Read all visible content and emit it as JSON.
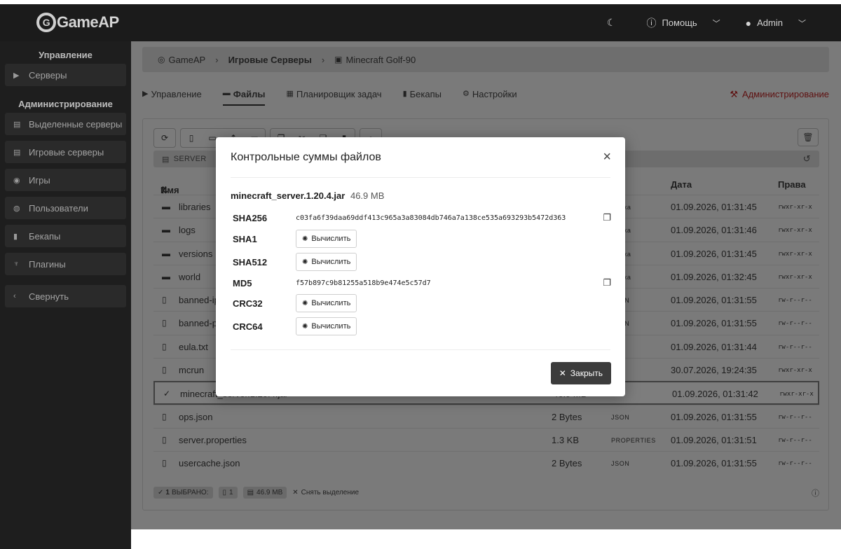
{
  "header": {
    "logo_text": "GameAP",
    "logo_glyph": "G",
    "help_label": "Помощь",
    "user_label": "Admin"
  },
  "sidebar": {
    "section_manage": "Управление",
    "section_admin": "Администрирование",
    "items": [
      {
        "label": "Серверы",
        "icon": "play-icon"
      },
      {
        "label": "Выделенные серверы",
        "icon": "server-icon"
      },
      {
        "label": "Игровые серверы",
        "icon": "server-icon"
      },
      {
        "label": "Игры",
        "icon": "gamepad-icon"
      },
      {
        "label": "Пользователи",
        "icon": "users-icon"
      },
      {
        "label": "Бекапы",
        "icon": "file-icon"
      },
      {
        "label": "Плагины",
        "icon": "plug-icon"
      },
      {
        "label": "Свернуть",
        "icon": "chevron-left-icon"
      }
    ]
  },
  "breadcrumb": {
    "home": "GameAP",
    "section": "Игровые Серверы",
    "server": "Minecraft Golf-90"
  },
  "tabs": {
    "manage": "Управление",
    "files": "Файлы",
    "scheduler": "Планировщик задач",
    "backups": "Бекапы",
    "settings": "Настройки",
    "admin": "Администрирование"
  },
  "filemanager": {
    "path": "SERVER",
    "columns": {
      "name": "Имя",
      "date": "Дата",
      "perms": "Права"
    },
    "rows": [
      {
        "icon": "folder",
        "name": "libraries",
        "size": "",
        "type": "Папка",
        "date": "01.09.2026, 01:31:45",
        "perms": "rwxr-xr-x"
      },
      {
        "icon": "folder",
        "name": "logs",
        "size": "",
        "type": "Папка",
        "date": "01.09.2026, 01:31:46",
        "perms": "rwxr-xr-x"
      },
      {
        "icon": "folder",
        "name": "versions",
        "size": "",
        "type": "Папка",
        "date": "01.09.2026, 01:31:45",
        "perms": "rwxr-xr-x"
      },
      {
        "icon": "folder",
        "name": "world",
        "size": "",
        "type": "Папка",
        "date": "01.09.2026, 01:32:45",
        "perms": "rwxr-xr-x"
      },
      {
        "icon": "file",
        "name": "banned-ips.json",
        "size": "",
        "type": "JSON",
        "date": "01.09.2026, 01:31:55",
        "perms": "rw-r--r--"
      },
      {
        "icon": "file",
        "name": "banned-players.json",
        "size": "",
        "type": "JSON",
        "date": "01.09.2026, 01:31:55",
        "perms": "rw-r--r--"
      },
      {
        "icon": "file",
        "name": "eula.txt",
        "size": "",
        "type": "",
        "date": "01.09.2026, 01:31:44",
        "perms": "rw-r--r--"
      },
      {
        "icon": "file",
        "name": "mcrun",
        "size": "",
        "type": "",
        "date": "30.07.2026, 19:24:35",
        "perms": "rwxr-xr-x"
      },
      {
        "icon": "check",
        "name": "minecraft_server.1.20.4.jar",
        "size": "46.9 MB",
        "type": "",
        "date": "01.09.2026, 01:31:42",
        "perms": "rwxr-xr-x",
        "selected": true
      },
      {
        "icon": "file",
        "name": "ops.json",
        "size": "2 Bytes",
        "type": "JSON",
        "date": "01.09.2026, 01:31:55",
        "perms": "rw-r--r--"
      },
      {
        "icon": "file",
        "name": "server.properties",
        "size": "1.3 KB",
        "type": "PROPERTIES",
        "date": "01.09.2026, 01:31:51",
        "perms": "rw-r--r--"
      },
      {
        "icon": "file",
        "name": "usercache.json",
        "size": "2 Bytes",
        "type": "JSON",
        "date": "01.09.2026, 01:31:55",
        "perms": "rw-r--r--"
      }
    ],
    "status": {
      "selected_count": "1",
      "selected_label": "ВЫБРАНО:",
      "files_count": "1",
      "total_size": "46.9 MB",
      "clear_label": "Снять выделение"
    }
  },
  "modal": {
    "title": "Контрольные суммы файлов",
    "filename": "minecraft_server.1.20.4.jar",
    "filesize": "46.9 MB",
    "hashes": [
      {
        "algo": "SHA256",
        "value": "c03fa6f39daa69ddf413c965a3a83084db746a7a138ce535a693293b5472d363"
      },
      {
        "algo": "SHA1",
        "value": null
      },
      {
        "algo": "SHA512",
        "value": null
      },
      {
        "algo": "MD5",
        "value": "f57b897c9b81255a518b9e474e5c57d7"
      },
      {
        "algo": "CRC32",
        "value": null
      },
      {
        "algo": "CRC64",
        "value": null
      }
    ],
    "calc_label": "Вычислить",
    "close_label": "Закрыть"
  },
  "colors": {
    "admin_accent": "#5e1010",
    "close_button": "#3c3c3c"
  }
}
